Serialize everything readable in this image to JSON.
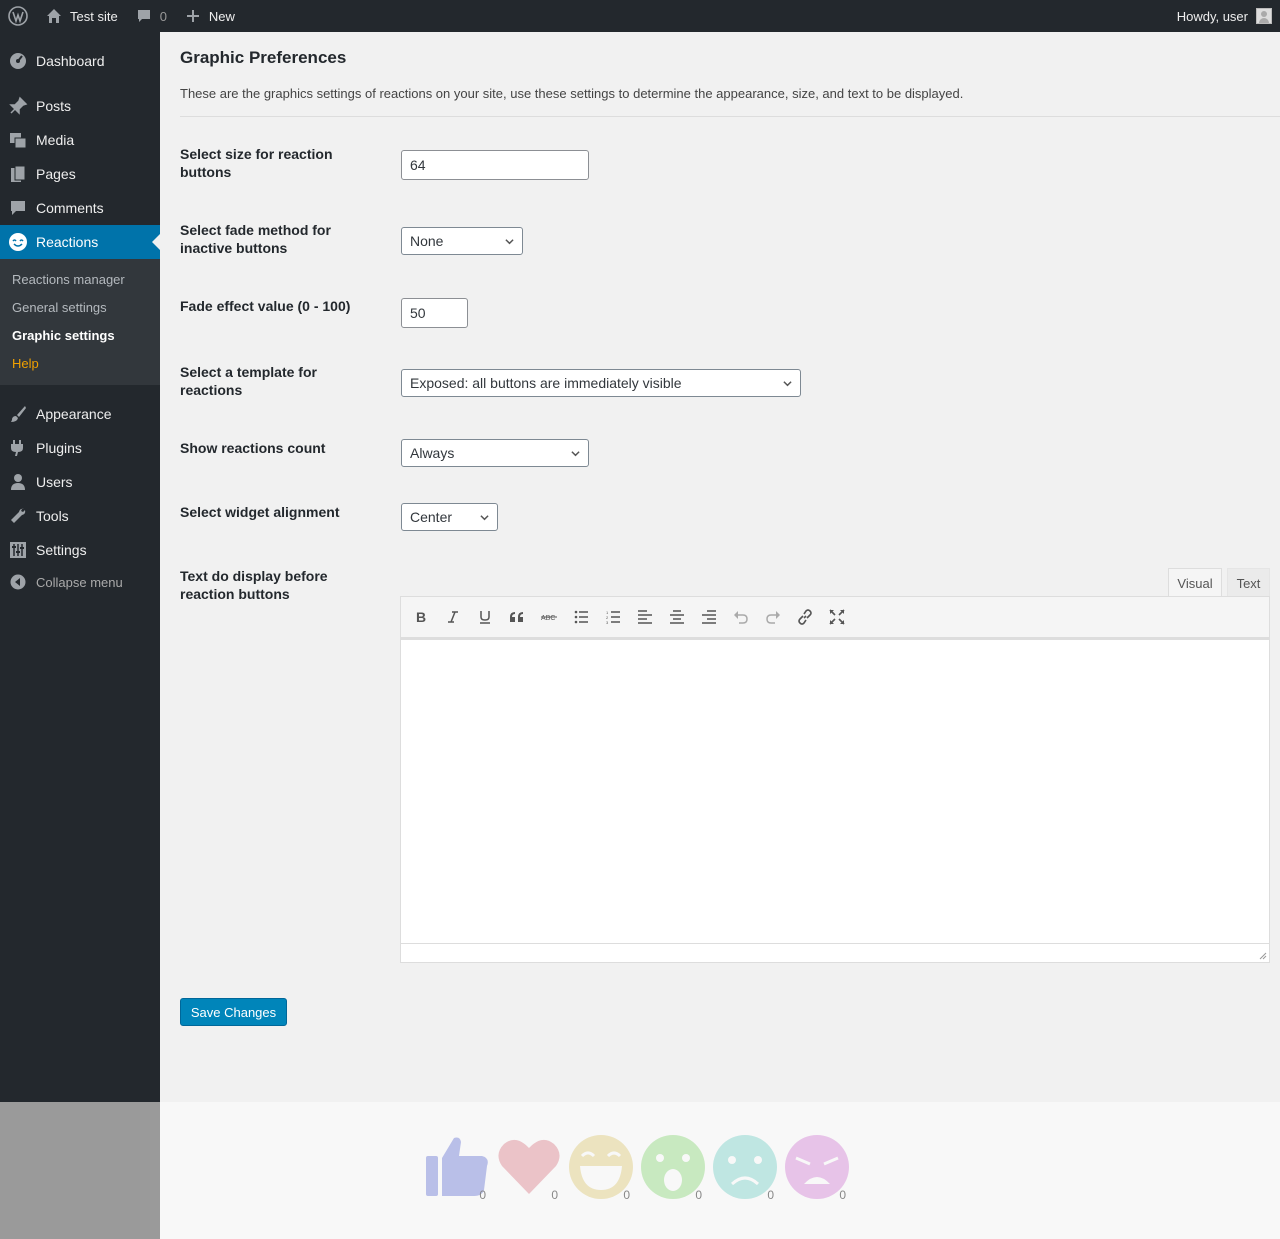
{
  "admin_bar": {
    "site_name": "Test site",
    "comments_count": "0",
    "new_label": "New",
    "greeting": "Howdy, user"
  },
  "sidebar": {
    "items": [
      {
        "label": "Dashboard",
        "icon": "dashboard-icon"
      },
      {
        "label": "Posts",
        "icon": "pin-icon"
      },
      {
        "label": "Media",
        "icon": "media-icon"
      },
      {
        "label": "Pages",
        "icon": "pages-icon"
      },
      {
        "label": "Comments",
        "icon": "comment-icon"
      },
      {
        "label": "Reactions",
        "icon": "smiley-icon"
      },
      {
        "label": "Appearance",
        "icon": "brush-icon"
      },
      {
        "label": "Plugins",
        "icon": "plug-icon"
      },
      {
        "label": "Users",
        "icon": "user-icon"
      },
      {
        "label": "Tools",
        "icon": "wrench-icon"
      },
      {
        "label": "Settings",
        "icon": "sliders-icon"
      }
    ],
    "submenu": [
      "Reactions manager",
      "General settings",
      "Graphic settings",
      "Help"
    ],
    "collapse_label": "Collapse menu"
  },
  "page": {
    "title": "Graphic Preferences",
    "description": "These are the graphics settings of reactions on your site, use these settings to determine the appearance, size, and text to be displayed."
  },
  "fields": {
    "size": {
      "label": "Select size for reaction buttons",
      "value": "64"
    },
    "fade_method": {
      "label": "Select fade method for inactive buttons",
      "value": "None"
    },
    "fade_value": {
      "label": "Fade effect value (0 - 100)",
      "value": "50"
    },
    "template": {
      "label": "Select a template for reactions",
      "value": "Exposed: all buttons are immediately visible"
    },
    "show_count": {
      "label": "Show reactions count",
      "value": "Always"
    },
    "alignment": {
      "label": "Select widget alignment",
      "value": "Center"
    },
    "text_before": {
      "label": "Text do display before reaction buttons"
    }
  },
  "editor": {
    "tabs": [
      "Visual",
      "Text"
    ],
    "toolbar": [
      "bold-icon",
      "italic-icon",
      "underline-icon",
      "quote-icon",
      "strikethrough-icon",
      "bullet-list-icon",
      "numbered-list-icon",
      "align-left-icon",
      "align-center-icon",
      "align-right-icon",
      "undo-icon",
      "redo-icon",
      "link-icon",
      "fullscreen-icon"
    ]
  },
  "save_label": "Save Changes",
  "reactions": [
    {
      "name": "like",
      "count": "0",
      "color": "#b9bfe8"
    },
    {
      "name": "love",
      "count": "0",
      "color": "#ebc3c8"
    },
    {
      "name": "haha",
      "count": "0",
      "color": "#ece3bf"
    },
    {
      "name": "wow",
      "count": "0",
      "color": "#c8e9c0"
    },
    {
      "name": "sad",
      "count": "0",
      "color": "#bfe6e2"
    },
    {
      "name": "angry",
      "count": "0",
      "color": "#e7c3e8"
    }
  ]
}
